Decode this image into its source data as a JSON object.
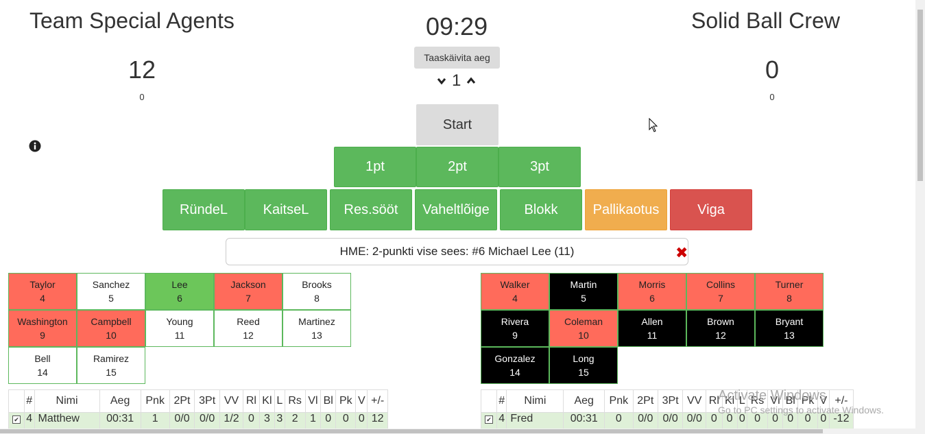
{
  "home": {
    "name": "Team Special Agents",
    "score": "12",
    "subscore": "0",
    "players": [
      {
        "name": "Taylor",
        "num": "4",
        "state": "red"
      },
      {
        "name": "Sanchez",
        "num": "5",
        "state": "white"
      },
      {
        "name": "Lee",
        "num": "6",
        "state": "green"
      },
      {
        "name": "Jackson",
        "num": "7",
        "state": "red"
      },
      {
        "name": "Brooks",
        "num": "8",
        "state": "white"
      },
      {
        "name": "Washington",
        "num": "9",
        "state": "red"
      },
      {
        "name": "Campbell",
        "num": "10",
        "state": "red"
      },
      {
        "name": "Young",
        "num": "11",
        "state": "white"
      },
      {
        "name": "Reed",
        "num": "12",
        "state": "white"
      },
      {
        "name": "Martinez",
        "num": "13",
        "state": "white"
      },
      {
        "name": "Bell",
        "num": "14",
        "state": "white"
      },
      {
        "name": "Ramirez",
        "num": "15",
        "state": "white"
      }
    ],
    "table_row": {
      "checked": "✔",
      "num": "4",
      "name": "Matthew",
      "aeg": "00:31",
      "pnk": "1",
      "p2": "0/0",
      "p3": "0/0",
      "vv": "1/2",
      "rl": "0",
      "kl": "3",
      "l": "3",
      "rs": "2",
      "vl": "1",
      "bl": "0",
      "pk": "0",
      "v": "0",
      "pm": "12"
    }
  },
  "away": {
    "name": "Solid Ball Crew",
    "score": "0",
    "subscore": "0",
    "players": [
      {
        "name": "Walker",
        "num": "4",
        "state": "red"
      },
      {
        "name": "Martin",
        "num": "5",
        "state": "black"
      },
      {
        "name": "Morris",
        "num": "6",
        "state": "red"
      },
      {
        "name": "Collins",
        "num": "7",
        "state": "red"
      },
      {
        "name": "Turner",
        "num": "8",
        "state": "red"
      },
      {
        "name": "Rivera",
        "num": "9",
        "state": "black"
      },
      {
        "name": "Coleman",
        "num": "10",
        "state": "red"
      },
      {
        "name": "Allen",
        "num": "11",
        "state": "black"
      },
      {
        "name": "Brown",
        "num": "12",
        "state": "black"
      },
      {
        "name": "Bryant",
        "num": "13",
        "state": "black"
      },
      {
        "name": "Gonzalez",
        "num": "14",
        "state": "black"
      },
      {
        "name": "Long",
        "num": "15",
        "state": "black"
      }
    ],
    "table_row": {
      "checked": "✔",
      "num": "4",
      "name": "Fred",
      "aeg": "00:31",
      "pnk": "0",
      "p2": "0/0",
      "p3": "0/0",
      "vv": "0/0",
      "rl": "0",
      "kl": "0",
      "l": "0",
      "rs": "0",
      "vl": "0",
      "bl": "0",
      "pk": "0",
      "v": "0",
      "pm": "-12"
    }
  },
  "clock": "09:29",
  "restart_label": "Taaskäivita aeg",
  "period": "1",
  "start_label": "Start",
  "point_buttons": [
    "1pt",
    "2pt",
    "3pt"
  ],
  "action_buttons": {
    "rundel": "RündeL",
    "kaitsel": "KaitseL",
    "ressoot": "Res.sööt",
    "vaheltloige": "Vaheltlõige",
    "blokk": "Blokk",
    "pallikaotus": "Pallikaotus",
    "viga": "Viga"
  },
  "message": "HME: 2-punkti vise sees: #6 Michael Lee (11)",
  "table_headers": [
    "#",
    "Nimi",
    "Aeg",
    "Pnk",
    "2Pt",
    "3Pt",
    "VV",
    "Rl",
    "Kl",
    "L",
    "Rs",
    "Vl",
    "Bl",
    "Pk",
    "V",
    "+/-"
  ],
  "watermark": {
    "title": "Activate Windows",
    "sub": "Go to PC settings to activate Windows."
  },
  "colors": {
    "green": "#5cb85c",
    "orange": "#f0ad4e",
    "red": "#d9534f",
    "player_red": "#ff6b5b"
  }
}
